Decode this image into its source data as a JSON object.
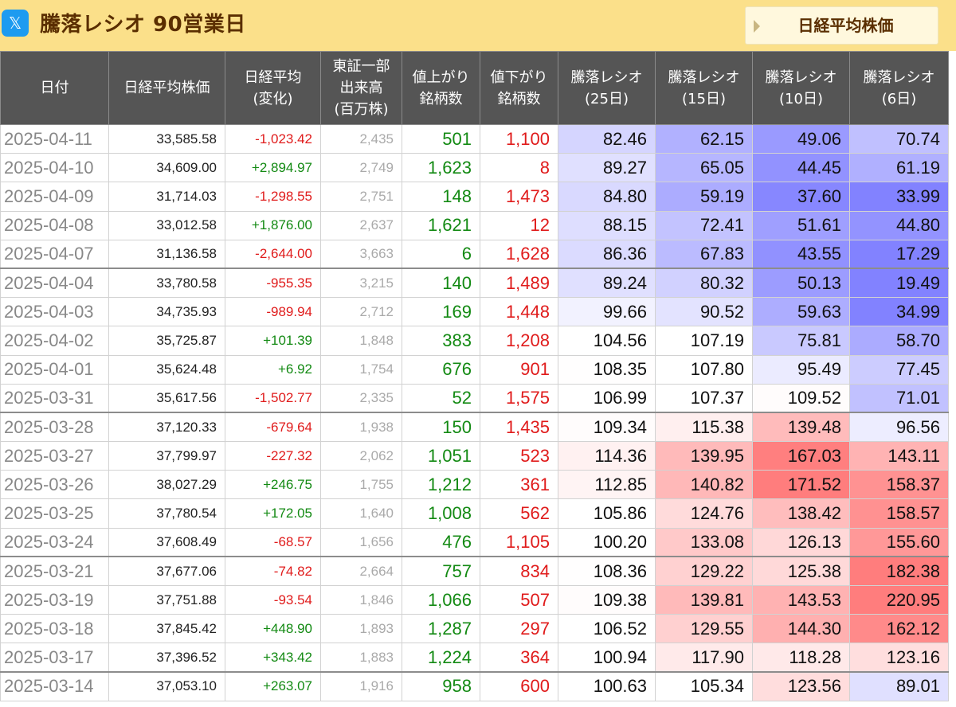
{
  "header": {
    "icon": "x-logo-icon",
    "title": "騰落レシオ 90営業日",
    "nav_button_label": "日経平均株価"
  },
  "colors": {
    "header_bg": "#fbe08a",
    "table_header_bg": "#555555",
    "positive": "#138a13",
    "negative": "#e01b1b"
  },
  "table": {
    "columns": [
      "日付",
      "日経平均株価",
      "日経平均\n(変化)",
      "東証一部\n出来高\n(百万株)",
      "値上がり\n銘柄数",
      "値下がり\n銘柄数",
      "騰落レシオ\n(25日)",
      "騰落レシオ\n(15日)",
      "騰落レシオ\n(10日)",
      "騰落レシオ\n(6日)"
    ],
    "rows": [
      {
        "date": "2025-04-11",
        "price": "33,585.58",
        "change": "-1,023.42",
        "volume": "2,435",
        "advances": "501",
        "declines": "1,100",
        "r25": "82.46",
        "r15": "62.15",
        "r10": "49.06",
        "r6": "70.74"
      },
      {
        "date": "2025-04-10",
        "price": "34,609.00",
        "change": "+2,894.97",
        "volume": "2,749",
        "advances": "1,623",
        "declines": "8",
        "r25": "89.27",
        "r15": "65.05",
        "r10": "44.45",
        "r6": "61.19"
      },
      {
        "date": "2025-04-09",
        "price": "31,714.03",
        "change": "-1,298.55",
        "volume": "2,751",
        "advances": "148",
        "declines": "1,473",
        "r25": "84.80",
        "r15": "59.19",
        "r10": "37.60",
        "r6": "33.99"
      },
      {
        "date": "2025-04-08",
        "price": "33,012.58",
        "change": "+1,876.00",
        "volume": "2,637",
        "advances": "1,621",
        "declines": "12",
        "r25": "88.15",
        "r15": "72.41",
        "r10": "51.61",
        "r6": "44.80"
      },
      {
        "date": "2025-04-07",
        "price": "31,136.58",
        "change": "-2,644.00",
        "volume": "3,663",
        "advances": "6",
        "declines": "1,628",
        "r25": "86.36",
        "r15": "67.83",
        "r10": "43.55",
        "r6": "17.29"
      },
      {
        "date": "2025-04-04",
        "price": "33,780.58",
        "change": "-955.35",
        "volume": "3,215",
        "advances": "140",
        "declines": "1,489",
        "r25": "89.24",
        "r15": "80.32",
        "r10": "50.13",
        "r6": "19.49"
      },
      {
        "date": "2025-04-03",
        "price": "34,735.93",
        "change": "-989.94",
        "volume": "2,712",
        "advances": "169",
        "declines": "1,448",
        "r25": "99.66",
        "r15": "90.52",
        "r10": "59.63",
        "r6": "34.99"
      },
      {
        "date": "2025-04-02",
        "price": "35,725.87",
        "change": "+101.39",
        "volume": "1,848",
        "advances": "383",
        "declines": "1,208",
        "r25": "104.56",
        "r15": "107.19",
        "r10": "75.81",
        "r6": "58.70"
      },
      {
        "date": "2025-04-01",
        "price": "35,624.48",
        "change": "+6.92",
        "volume": "1,754",
        "advances": "676",
        "declines": "901",
        "r25": "108.35",
        "r15": "107.80",
        "r10": "95.49",
        "r6": "77.45"
      },
      {
        "date": "2025-03-31",
        "price": "35,617.56",
        "change": "-1,502.77",
        "volume": "2,335",
        "advances": "52",
        "declines": "1,575",
        "r25": "106.99",
        "r15": "107.37",
        "r10": "109.52",
        "r6": "71.01"
      },
      {
        "date": "2025-03-28",
        "price": "37,120.33",
        "change": "-679.64",
        "volume": "1,938",
        "advances": "150",
        "declines": "1,435",
        "r25": "109.34",
        "r15": "115.38",
        "r10": "139.48",
        "r6": "96.56"
      },
      {
        "date": "2025-03-27",
        "price": "37,799.97",
        "change": "-227.32",
        "volume": "2,062",
        "advances": "1,051",
        "declines": "523",
        "r25": "114.36",
        "r15": "139.95",
        "r10": "167.03",
        "r6": "143.11"
      },
      {
        "date": "2025-03-26",
        "price": "38,027.29",
        "change": "+246.75",
        "volume": "1,755",
        "advances": "1,212",
        "declines": "361",
        "r25": "112.85",
        "r15": "140.82",
        "r10": "171.52",
        "r6": "158.37"
      },
      {
        "date": "2025-03-25",
        "price": "37,780.54",
        "change": "+172.05",
        "volume": "1,640",
        "advances": "1,008",
        "declines": "562",
        "r25": "105.86",
        "r15": "124.76",
        "r10": "138.42",
        "r6": "158.57"
      },
      {
        "date": "2025-03-24",
        "price": "37,608.49",
        "change": "-68.57",
        "volume": "1,656",
        "advances": "476",
        "declines": "1,105",
        "r25": "100.20",
        "r15": "133.08",
        "r10": "126.13",
        "r6": "155.60"
      },
      {
        "date": "2025-03-21",
        "price": "37,677.06",
        "change": "-74.82",
        "volume": "2,664",
        "advances": "757",
        "declines": "834",
        "r25": "108.36",
        "r15": "129.22",
        "r10": "125.38",
        "r6": "182.38"
      },
      {
        "date": "2025-03-19",
        "price": "37,751.88",
        "change": "-93.54",
        "volume": "1,846",
        "advances": "1,066",
        "declines": "507",
        "r25": "109.38",
        "r15": "139.81",
        "r10": "143.53",
        "r6": "220.95"
      },
      {
        "date": "2025-03-18",
        "price": "37,845.42",
        "change": "+448.90",
        "volume": "1,893",
        "advances": "1,287",
        "declines": "297",
        "r25": "106.52",
        "r15": "129.55",
        "r10": "144.30",
        "r6": "162.12"
      },
      {
        "date": "2025-03-17",
        "price": "37,396.52",
        "change": "+343.42",
        "volume": "1,883",
        "advances": "1,224",
        "declines": "364",
        "r25": "100.94",
        "r15": "117.90",
        "r10": "118.28",
        "r6": "123.16"
      },
      {
        "date": "2025-03-14",
        "price": "37,053.10",
        "change": "+263.07",
        "volume": "1,916",
        "advances": "958",
        "declines": "600",
        "r25": "100.63",
        "r15": "105.34",
        "r10": "123.56",
        "r6": "89.01"
      }
    ]
  }
}
